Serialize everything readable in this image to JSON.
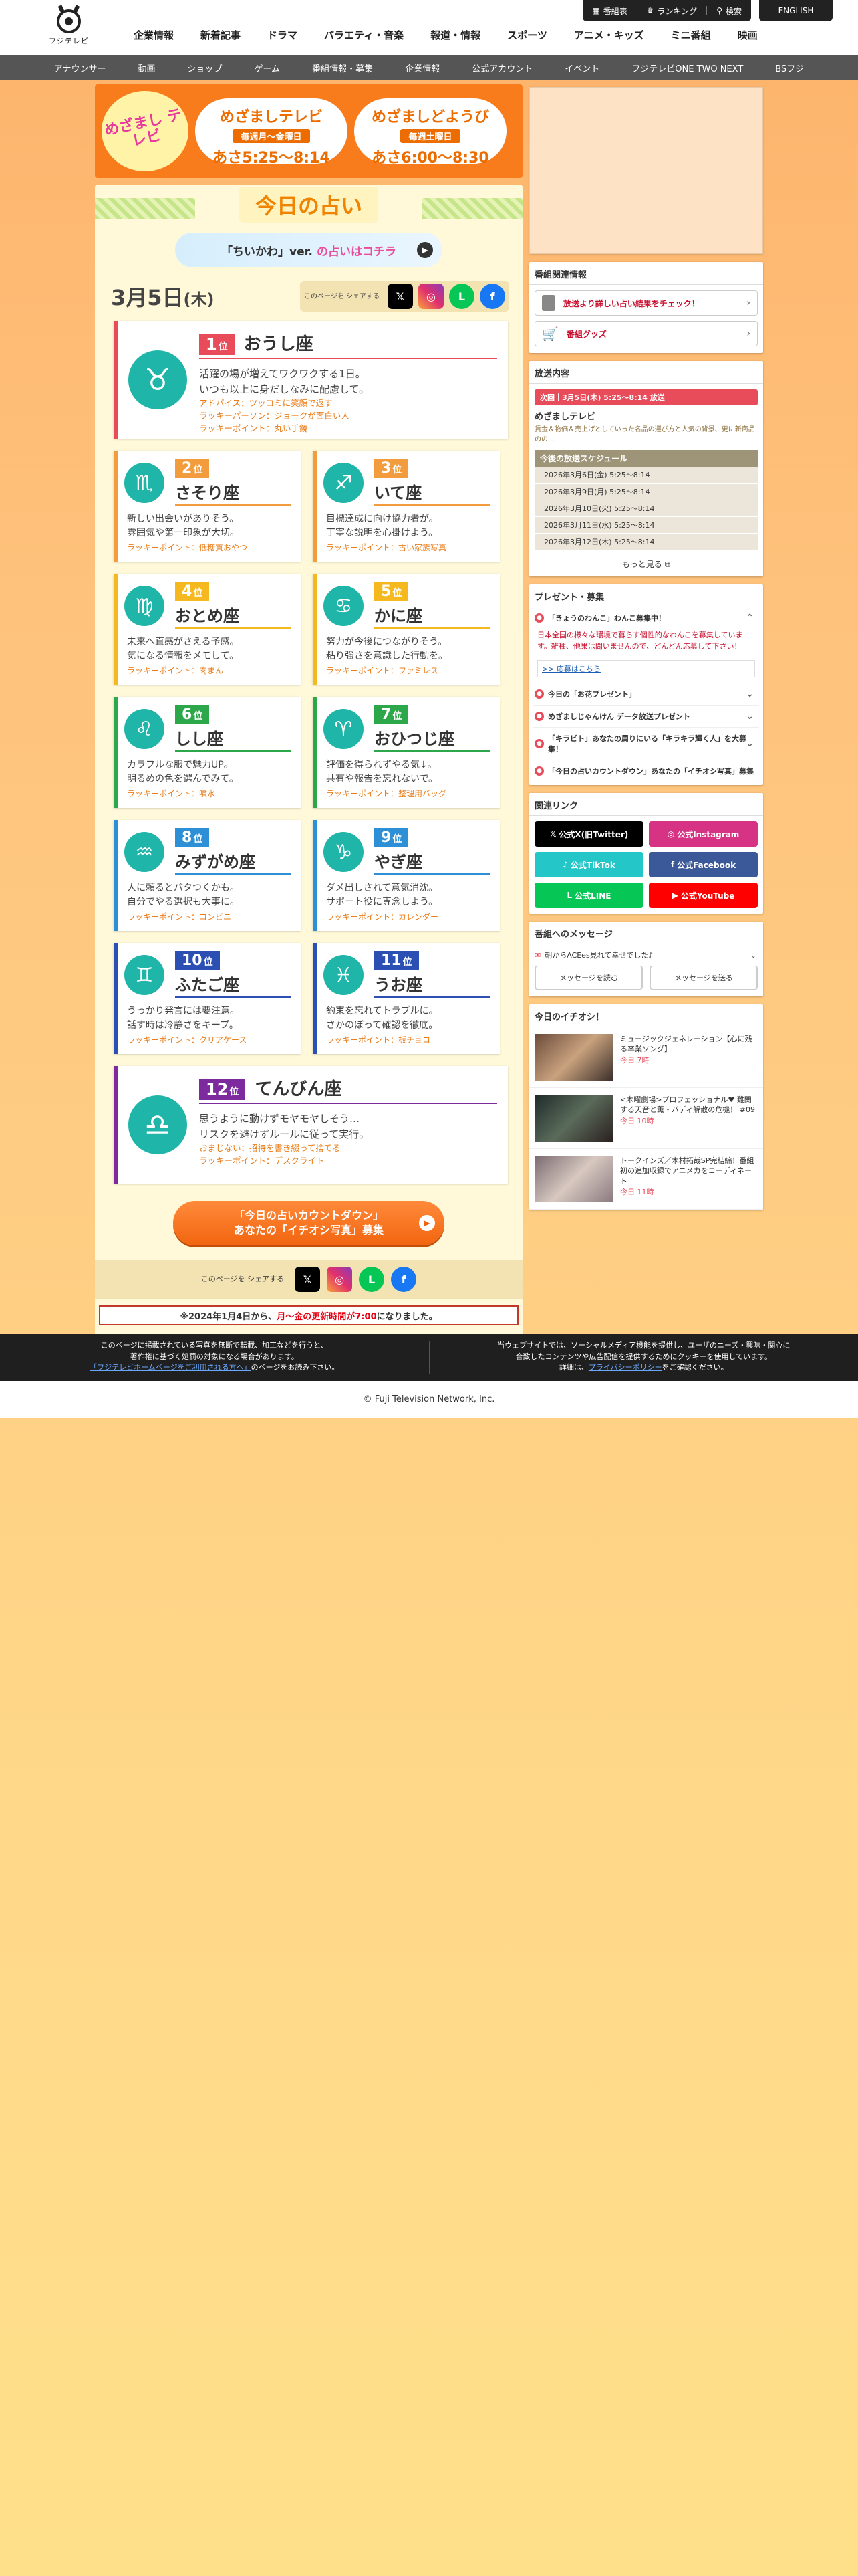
{
  "header": {
    "logo_text": "フジテレビ",
    "util_links": [
      "番組表",
      "ランキング",
      "検索"
    ],
    "english": "ENGLISH",
    "gnav": [
      "企業情報",
      "新着記事",
      "ドラマ",
      "バラエティ・音楽",
      "報道・情報",
      "スポーツ",
      "アニメ・キッズ",
      "ミニ番組",
      "映画"
    ],
    "subnav": [
      "アナウンサー",
      "動画",
      "ショップ",
      "ゲーム",
      "番組情報・募集",
      "企業情報",
      "公式アカウント",
      "イベント",
      "フジテレビONE TWO NEXT",
      "BSフジ"
    ]
  },
  "banner": {
    "logo": "めざまし テレビ",
    "show1": {
      "name": "めざましテレビ",
      "days": "毎週月〜金曜日",
      "time": "あさ5:25〜8:14"
    },
    "show2": {
      "name": "めざましどようび",
      "days": "毎週土曜日",
      "time": "あさ6:00〜8:30"
    }
  },
  "fortune": {
    "title": "今日の占い",
    "chiikawa_a": "「ちいかわ」ver.",
    "chiikawa_b": "の占いはコチラ",
    "date": "3月5日",
    "weekday": "(木)",
    "share_label": "このページを シェアする",
    "rank_suffix": "位",
    "signs": [
      {
        "rank": 1,
        "name": "おうし座",
        "symbol": "♉",
        "desc1": "活躍の場が増えてワクワクする1日。",
        "desc2": "いつも以上に身だしなみに配慮して。",
        "lucky": [
          "アドバイス：ツッコミに笑顔で返す",
          "ラッキーパーソン：ジョークが面白い人",
          "ラッキーポイント：丸い手鏡"
        ],
        "color": "#e84c5a"
      },
      {
        "rank": 2,
        "name": "さそり座",
        "symbol": "♏",
        "desc1": "新しい出会いがありそう。",
        "desc2": "雰囲気や第一印象が大切。",
        "lucky": [
          "ラッキーポイント：低糖質おやつ"
        ],
        "color": "#f39c3d"
      },
      {
        "rank": 3,
        "name": "いて座",
        "symbol": "♐",
        "desc1": "目標達成に向け協力者が。",
        "desc2": "丁寧な説明を心掛けよう。",
        "lucky": [
          "ラッキーポイント：古い家族写真"
        ],
        "color": "#f39c3d"
      },
      {
        "rank": 4,
        "name": "おとめ座",
        "symbol": "♍",
        "desc1": "未来へ直感がさえる予感。",
        "desc2": "気になる情報をメモして。",
        "lucky": [
          "ラッキーポイント：肉まん"
        ],
        "color": "#f5b81e"
      },
      {
        "rank": 5,
        "name": "かに座",
        "symbol": "♋",
        "desc1": "努力が今後につながりそう。",
        "desc2": "粘り強さを意識した行動を。",
        "lucky": [
          "ラッキーポイント：ファミレス"
        ],
        "color": "#f5b81e"
      },
      {
        "rank": 6,
        "name": "しし座",
        "symbol": "♌",
        "desc1": "カラフルな服で魅力UP。",
        "desc2": "明るめの色を選んでみて。",
        "lucky": [
          "ラッキーポイント：噴水"
        ],
        "color": "#2ca84a"
      },
      {
        "rank": 7,
        "name": "おひつじ座",
        "symbol": "♈",
        "desc1": "評価を得られずやる気↓。",
        "desc2": "共有や報告を忘れないで。",
        "lucky": [
          "ラッキーポイント：整理用バッグ"
        ],
        "color": "#2ca84a"
      },
      {
        "rank": 8,
        "name": "みずがめ座",
        "symbol": "♒",
        "desc1": "人に頼るとバタつくかも。",
        "desc2": "自分でやる選択も大事に。",
        "lucky": [
          "ラッキーポイント：コンビニ"
        ],
        "color": "#2d8fd5"
      },
      {
        "rank": 9,
        "name": "やぎ座",
        "symbol": "♑",
        "desc1": "ダメ出しされて意気消沈。",
        "desc2": "サポート役に専念しよう。",
        "lucky": [
          "ラッキーポイント：カレンダー"
        ],
        "color": "#2d8fd5"
      },
      {
        "rank": 10,
        "name": "ふたご座",
        "symbol": "♊",
        "desc1": "うっかり発言には要注意。",
        "desc2": "話す時は冷静さをキープ。",
        "lucky": [
          "ラッキーポイント：クリアケース"
        ],
        "color": "#2b4fb3"
      },
      {
        "rank": 11,
        "name": "うお座",
        "symbol": "♓",
        "desc1": "約束を忘れてトラブルに。",
        "desc2": "さかのぼって確認を徹底。",
        "lucky": [
          "ラッキーポイント：板チョコ"
        ],
        "color": "#2b4fb3"
      },
      {
        "rank": 12,
        "name": "てんびん座",
        "symbol": "♎",
        "desc1": "思うように動けずモヤモヤしそう…",
        "desc2": "リスクを避けずルールに従って実行。",
        "lucky": [
          "おまじない：招待を書き綴って捨てる",
          "ラッキーポイント：デスクライト"
        ],
        "color": "#7d2a9e"
      }
    ],
    "cta_line1": "「今日の占いカウントダウン」",
    "cta_line2": "あなたの「イチオシ写真」募集",
    "notice_a": "※2024年1月4日から、",
    "notice_b": "月〜金の更新時間が7:00",
    "notice_c": "になりました。"
  },
  "sidebar": {
    "related": {
      "title": "番組関連情報",
      "btn1": "放送より詳しい占い結果をチェック！",
      "btn2": "番組グッズ"
    },
    "broadcast": {
      "title": "放送内容",
      "next": "次回｜3月5日(木) 5:25〜8:14 放送",
      "program": "めざましテレビ",
      "desc": "賃金＆物価＆売上げとしていった名品の選び方と人気の背景、更に新商品のの...",
      "sched_title": "今後の放送スケジュール",
      "schedule": [
        "2026年3月6日(金) 5:25〜8:14",
        "2026年3月9日(月) 5:25〜8:14",
        "2026年3月10日(火) 5:25〜8:14",
        "2026年3月11日(水) 5:25〜8:14",
        "2026年3月12日(木) 5:25〜8:14"
      ],
      "more": "もっと見る"
    },
    "present": {
      "title": "プレゼント・募集",
      "items": [
        {
          "label": "「きょうのわんこ」わんこ募集中！",
          "open": true,
          "body": "日本全国の様々な環境で暮らす個性的なわんこを募集しています。雑種、他果は問いませんので、どんどん応募して下さい！",
          "link": ">> 応募はこちら"
        },
        {
          "label": "今日の「お花プレゼント」"
        },
        {
          "label": "めざましじゃんけん データ放送プレゼント"
        },
        {
          "label": "「キラビト」あなたの周りにいる「キラキラ輝く人」を大募集！"
        },
        {
          "label": "「今日の占いカウントダウン」あなたの「イチオシ写真」募集"
        }
      ]
    },
    "links": {
      "title": "関連リンク",
      "items": [
        {
          "label": "公式X(旧Twitter)",
          "color": "#000000"
        },
        {
          "label": "公式Instagram",
          "color": "#d63384"
        },
        {
          "label": "公式TikTok",
          "color": "#25c6c8"
        },
        {
          "label": "公式Facebook",
          "color": "#3b5998"
        },
        {
          "label": "公式LINE",
          "color": "#06c755"
        },
        {
          "label": "公式YouTube",
          "color": "#ff0000"
        }
      ]
    },
    "message": {
      "title": "番組へのメッセージ",
      "head": "朝からACEes見れて幸せでした♪",
      "read": "メッセージを読む",
      "send": "メッセージを送る"
    },
    "picks": {
      "title": "今日のイチオシ！",
      "items": [
        {
          "title": "ミュージックジェネレーション【心に残る卒業ソング】",
          "time": "今日 7時"
        },
        {
          "title": "<木曜劇場>プロフェッショナル♥ 難関する天音と薫・バディ解散の危機！ #09",
          "time": "今日 10時"
        },
        {
          "title": "トークインズ／木村拓哉SP完結編！番組初の追加収録でアニメカをコーディネート",
          "time": "今日 11時"
        }
      ]
    }
  },
  "footer": {
    "left1": "このページに掲載されている写真を無断で転載、加工などを行うと、",
    "left2": "著作権に基づく処罰の対象になる場合があります。",
    "left_link": "「フジテレビホームページをご利用される方へ」",
    "left3": "のページをお読み下さい。",
    "right1": "当ウェブサイトでは、ソーシャルメディア機能を提供し、ユーザのニーズ・興味・関心に",
    "right2": "合致したコンテンツや広告配信を提供するためにクッキーを使用しています。",
    "right_a": "詳細は、",
    "right_link": "プライバシーポリシー",
    "right_b": "をご確認ください。",
    "copyright": "© Fuji Television Network, Inc."
  }
}
